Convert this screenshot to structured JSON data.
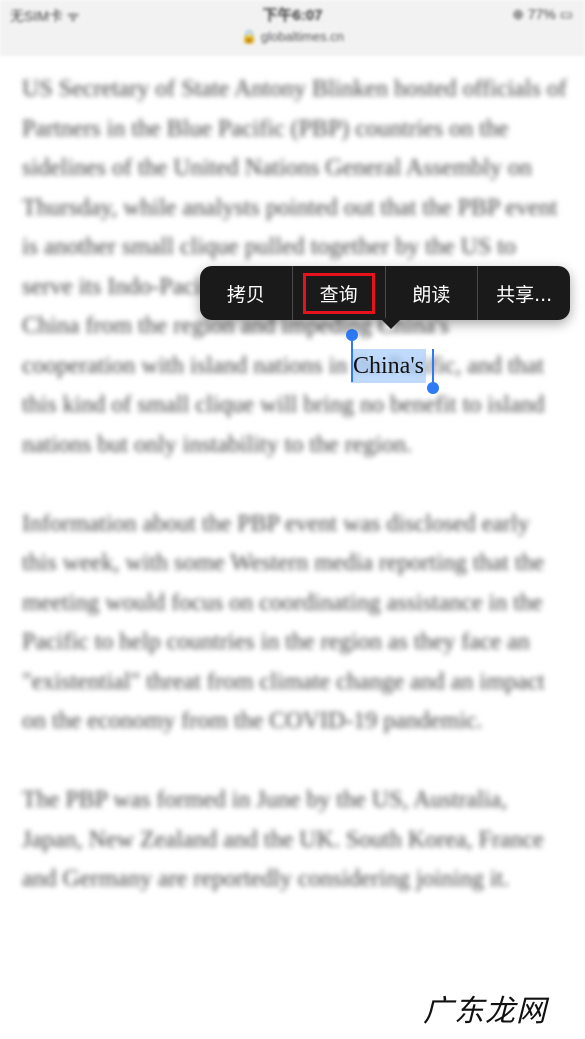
{
  "status_bar": {
    "left": "无SIM卡 ᯤ",
    "time": "下午6:07",
    "url": "🔒 globaltimes.cn",
    "right": "⊕ 77% ▭"
  },
  "article": {
    "paragraphs": [
      "US Secretary of State Antony Blinken hosted officials of Partners in the Blue Pacific (PBP) countries on the sidelines of the United Nations General Assembly on Thursday, while analysts pointed out that the PBP event is another small clique pulled together by the US to serve its Indo-Pacific Strategy with the aim of squeezing China from the region and impeding China's cooperation with island nations in the Pacific, and that this kind of small clique will bring no benefit to island nations but only instability to the region.",
      "Information about the PBP event was disclosed early this week, with some Western media reporting that the meeting would focus on coordinating assistance in the Pacific to help countries in the region as they face an \"existential\" threat from climate change and an impact on the economy from the COVID-19 pandemic.",
      "The PBP was formed in June by the US, Australia, Japan, New Zealand and the UK. South Korea, France and Germany are reportedly considering joining it."
    ],
    "selected_word": "China's"
  },
  "context_menu": {
    "items": [
      {
        "label": "拷贝"
      },
      {
        "label": "查询"
      },
      {
        "label": "朗读"
      },
      {
        "label": "共享..."
      }
    ],
    "highlight_color": "#e8121c"
  },
  "watermark": "广东龙网",
  "colors": {
    "selection_blue": "#2f7bf6",
    "menu_background": "#1a1a1a"
  }
}
